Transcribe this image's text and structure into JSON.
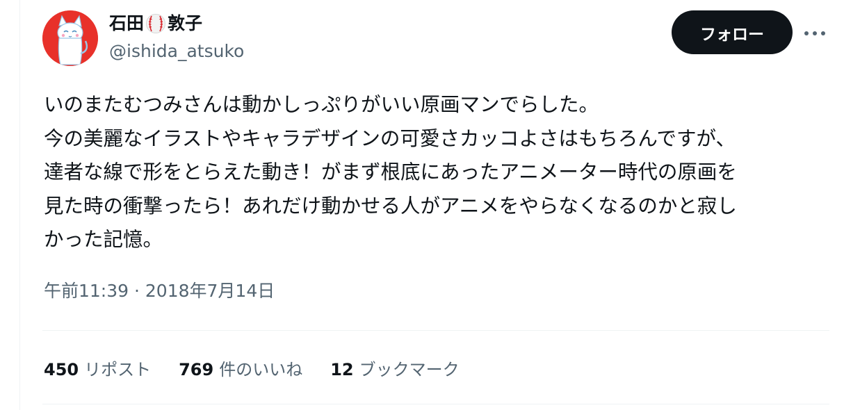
{
  "author": {
    "name_part1": "石田",
    "name_emoji": "baseball-icon",
    "name_part2": "敦子",
    "handle": "@ishida_atsuko",
    "avatar": "white-cat-illustration-on-red"
  },
  "header": {
    "follow_label": "フォロー",
    "more_icon": "more-dots-icon"
  },
  "tweet": {
    "lines": [
      "いのまたむつみさんは動かしっぷりがいい原画マンでらした。",
      "今の美麗なイラストやキャラデザインの可愛さカッコよさはもちろんですが、",
      "達者な線で形をとらえた動き！がまず根底にあったアニメーター時代の原画を",
      "見た時の衝撃ったら！あれだけ動かせる人がアニメをやらなくなるのかと寂し",
      "かった記憶。"
    ],
    "timestamp": "午前11:39 · 2018年7月14日"
  },
  "stats": [
    {
      "count": "450",
      "label": "リポスト"
    },
    {
      "count": "769",
      "label": "件のいいね"
    },
    {
      "count": "12",
      "label": "ブックマーク"
    }
  ],
  "colors": {
    "text_primary": "#0f1419",
    "text_secondary": "#536471",
    "follow_bg": "#0f1419",
    "avatar_bg": "#e8312a",
    "divider": "#eff3f4"
  }
}
